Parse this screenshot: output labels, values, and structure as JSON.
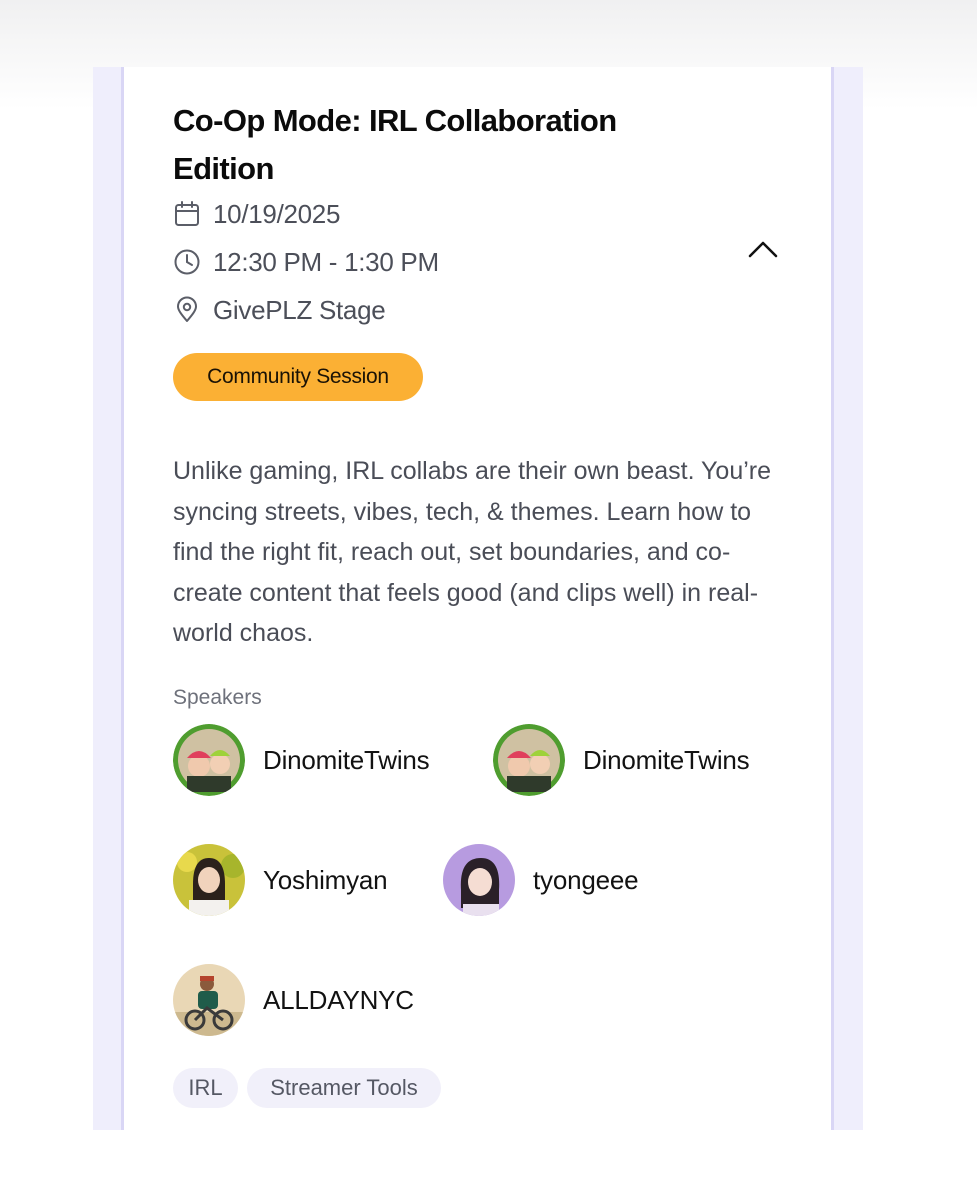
{
  "event": {
    "title": "Co-Op Mode: IRL Collaboration Edition",
    "date": "10/19/2025",
    "time": "12:30 PM - 1:30 PM",
    "location": "GivePLZ Stage",
    "category": "Community Session",
    "description": "Unlike gaming, IRL collabs are their own beast. You’re syncing streets, vibes, tech, & themes. Learn how to find the right fit, reach out, set boundaries, and co-create content that feels good (and clips well) in real-world chaos.",
    "speakers_label": "Speakers",
    "speakers": [
      {
        "name": "DinomiteTwins"
      },
      {
        "name": "DinomiteTwins"
      },
      {
        "name": "Yoshimyan"
      },
      {
        "name": "tyongeee"
      },
      {
        "name": "ALLDAYNYC"
      }
    ],
    "tags": [
      "IRL",
      "Streamer Tools"
    ]
  },
  "icons": {
    "date": "calendar-icon",
    "time": "clock-icon",
    "location": "map-pin-icon",
    "collapse": "chevron-up-icon"
  },
  "colors": {
    "category_pill": "#fbb034",
    "side_panel": "#efeefc",
    "tag_background": "#f1f0fa"
  }
}
